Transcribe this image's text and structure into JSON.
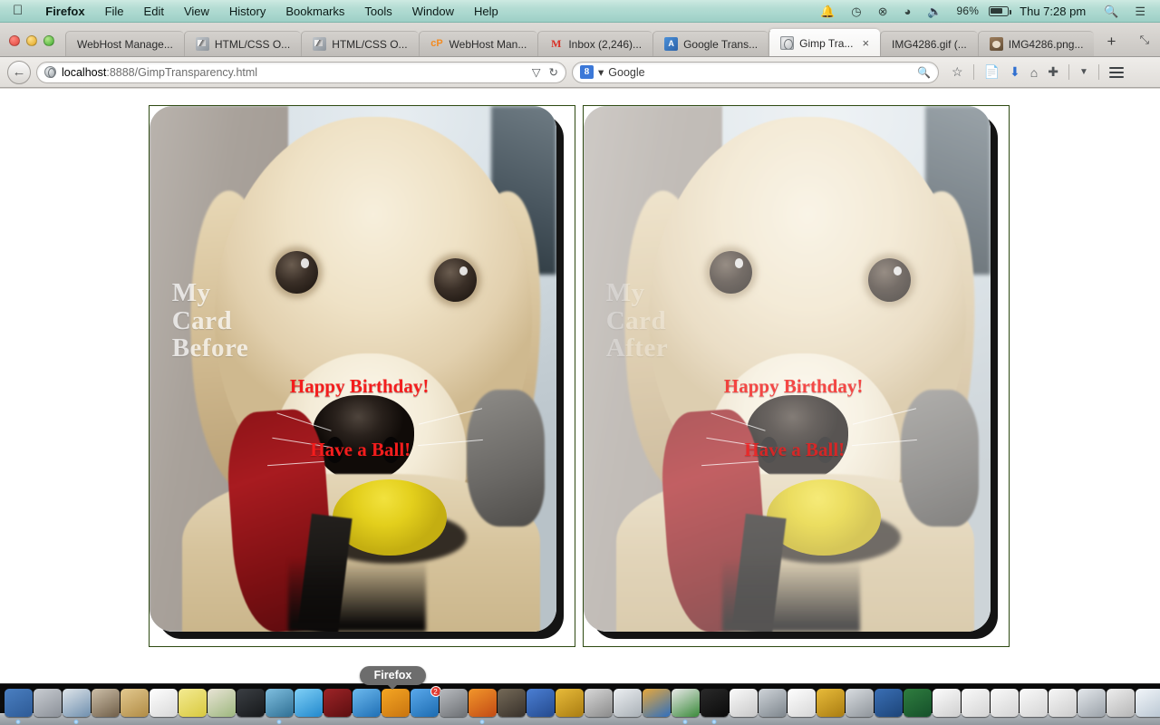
{
  "menubar": {
    "apple_icon": "apple-logo",
    "items": [
      "Firefox",
      "File",
      "Edit",
      "View",
      "History",
      "Bookmarks",
      "Tools",
      "Window",
      "Help"
    ],
    "status_icons": [
      "bell-icon",
      "time-machine-icon",
      "bluetooth-icon",
      "wifi-icon",
      "volume-icon"
    ],
    "battery_percent": "96%",
    "clock": "Thu 7:28 pm",
    "spotlight_icon": "search-icon",
    "notification_icon": "notification-center-icon"
  },
  "browser": {
    "window_controls": [
      "close",
      "minimize",
      "zoom"
    ],
    "tabs": [
      {
        "title": "WebHost Manage...",
        "favicon": "none",
        "active": false,
        "closable": false
      },
      {
        "title": "HTML/CSS O...",
        "favicon": "css-icon",
        "active": false,
        "closable": false
      },
      {
        "title": "HTML/CSS O...",
        "favicon": "css-icon",
        "active": false,
        "closable": false
      },
      {
        "title": "WebHost Man...",
        "favicon": "cpanel-icon",
        "active": false,
        "closable": false
      },
      {
        "title": "Inbox (2,246)...",
        "favicon": "gmail-icon",
        "active": false,
        "closable": false
      },
      {
        "title": "Google Trans...",
        "favicon": "google-translate-icon",
        "active": false,
        "closable": false
      },
      {
        "title": "Gimp Tra...",
        "favicon": "globe-icon",
        "active": true,
        "closable": true
      },
      {
        "title": "IMG4286.gif (...",
        "favicon": "none",
        "active": false,
        "closable": false
      },
      {
        "title": "IMG4286.png...",
        "favicon": "image-thumbnail-icon",
        "active": false,
        "closable": false
      }
    ],
    "new_tab_label": "+",
    "list_all_tabs_label": "⤡",
    "close_label": "×",
    "back_label": "←",
    "url_host": "localhost",
    "url_rest": ":8888/GimpTransparency.html",
    "url_dropdown_label": "▽",
    "url_reload_label": "↻",
    "search_engine_badge": "8",
    "search_engine_name": "Google",
    "search_dropdown_label": "▾",
    "search_magnifier_label": "search-icon",
    "toolbar_icons": [
      "bookmark-star-icon",
      "reading-list-icon",
      "downloads-icon",
      "home-icon",
      "addon-icon",
      "toolbar-overflow-icon",
      "menu-hamburger-icon"
    ]
  },
  "page": {
    "cards": [
      {
        "id": "card-before",
        "label_lines": [
          "My",
          "Card",
          "Before"
        ],
        "message_1": "Happy Birthday!",
        "message_2": "Have a Ball!",
        "label_opacity": "0.70",
        "overlay_wash": "none"
      },
      {
        "id": "card-after",
        "label_lines": [
          "My",
          "Card",
          "After"
        ],
        "message_1": "Happy Birthday!",
        "message_2": "Have a Ball!",
        "label_opacity": "0.30",
        "overlay_wash": "rgba(255,255,255,0.30)"
      }
    ],
    "border_color": "#2e4a12",
    "message_color": "#f41d1d",
    "label_color": "#ffffff",
    "background_color": "#ffffff"
  },
  "dock": {
    "tooltip": "Firefox",
    "items": [
      {
        "name": "finder",
        "colors": [
          "#4a7fc1",
          "#2d5a96"
        ]
      },
      {
        "name": "launchpad",
        "colors": [
          "#c9cdd2",
          "#8b9098"
        ]
      },
      {
        "name": "safari",
        "colors": [
          "#dfe5ea",
          "#6f8fae"
        ]
      },
      {
        "name": "contacts",
        "colors": [
          "#cdbfa8",
          "#6f5e48"
        ]
      },
      {
        "name": "notes-folder",
        "colors": [
          "#e3c98f",
          "#b08b45"
        ]
      },
      {
        "name": "calendar",
        "colors": [
          "#ffffff",
          "#d8d8d8"
        ]
      },
      {
        "name": "stickies",
        "colors": [
          "#f4eb92",
          "#d8c93f"
        ]
      },
      {
        "name": "maps",
        "colors": [
          "#e9e4d6",
          "#9db77e"
        ]
      },
      {
        "name": "photo-booth",
        "colors": [
          "#3b3f44",
          "#16181a"
        ]
      },
      {
        "name": "photos",
        "colors": [
          "#7fbfe0",
          "#2f6f93"
        ]
      },
      {
        "name": "messages",
        "colors": [
          "#7fd0f7",
          "#2288cc"
        ]
      },
      {
        "name": "address-book",
        "colors": [
          "#9d2427",
          "#5c0e10"
        ]
      },
      {
        "name": "itunes",
        "colors": [
          "#6cb9ee",
          "#1f6fb5"
        ]
      },
      {
        "name": "ibooks",
        "colors": [
          "#f5a623",
          "#c87410"
        ]
      },
      {
        "name": "app-store",
        "colors": [
          "#5aa9ec",
          "#1c6bb0"
        ]
      },
      {
        "name": "system-preferences",
        "colors": [
          "#b9bcc0",
          "#6b6e72"
        ]
      },
      {
        "name": "firefox",
        "colors": [
          "#f2962b",
          "#c24a14"
        ]
      },
      {
        "name": "gimp",
        "colors": [
          "#756a58",
          "#37302a"
        ]
      },
      {
        "name": "xcode-tools",
        "colors": [
          "#4b7fd4",
          "#244a8e"
        ]
      },
      {
        "name": "coda",
        "colors": [
          "#e8bb3a",
          "#a97c11"
        ]
      },
      {
        "name": "espresso",
        "colors": [
          "#d8d8d8",
          "#8a8a8a"
        ]
      },
      {
        "name": "fetch",
        "colors": [
          "#eceff2",
          "#a9b0b6"
        ]
      },
      {
        "name": "paintbrush",
        "colors": [
          "#e7a83c",
          "#2f6fbe"
        ]
      },
      {
        "name": "chrome",
        "colors": [
          "#e9e9e9",
          "#3a8a3a"
        ]
      },
      {
        "name": "terminal",
        "colors": [
          "#2a2a2a",
          "#0a0a0a"
        ]
      },
      {
        "name": "text-editor",
        "colors": [
          "#fbfbfb",
          "#c8c8c8"
        ]
      },
      {
        "name": "image-viewer",
        "colors": [
          "#cfd4d9",
          "#7d858c"
        ]
      },
      {
        "name": "blank-document",
        "colors": [
          "#ffffff",
          "#d6d6d6"
        ]
      },
      {
        "name": "coda-2",
        "colors": [
          "#e8bb3a",
          "#a97c11"
        ]
      },
      {
        "name": "scanner",
        "colors": [
          "#d9dde1",
          "#8e949a"
        ]
      },
      {
        "name": "display-prefs",
        "colors": [
          "#3a6fb5",
          "#1c4478"
        ]
      },
      {
        "name": "green-screen",
        "colors": [
          "#2f7d3f",
          "#15502a"
        ]
      },
      {
        "name": "white-window",
        "colors": [
          "#fdfdfd",
          "#cfcfcf"
        ]
      },
      {
        "name": "doc-1",
        "colors": [
          "#fafafa",
          "#d4d4d4"
        ]
      },
      {
        "name": "doc-2",
        "colors": [
          "#fafafa",
          "#d4d4d4"
        ]
      },
      {
        "name": "doc-3",
        "colors": [
          "#fafafa",
          "#d4d4d4"
        ]
      },
      {
        "name": "doc-4",
        "colors": [
          "#f7f7f7",
          "#cccccc"
        ]
      },
      {
        "name": "screen-doc",
        "colors": [
          "#e4e8ec",
          "#9aa1a8"
        ]
      },
      {
        "name": "grid-doc",
        "colors": [
          "#eeeeee",
          "#b5b5b5"
        ]
      },
      {
        "name": "window-doc-1",
        "colors": [
          "#f2f6fa",
          "#b9c6d2"
        ]
      },
      {
        "name": "window-doc-2",
        "colors": [
          "#f2f6fa",
          "#b9c6d2"
        ]
      },
      {
        "name": "window-doc-3",
        "colors": [
          "#f2f6fa",
          "#b9c6d2"
        ]
      },
      {
        "name": "window-doc-4",
        "colors": [
          "#f2f6fa",
          "#b9c6d2"
        ]
      },
      {
        "name": "window-doc-5",
        "colors": [
          "#fafafa",
          "#cdd5dc"
        ]
      },
      {
        "name": "brick-doc",
        "colors": [
          "#8d4a3c",
          "#5d2d23"
        ]
      },
      {
        "name": "report-doc",
        "colors": [
          "#fbfbfb",
          "#cfcfcf"
        ]
      },
      {
        "name": "tool-1",
        "colors": [
          "#e6e6e6",
          "#a8a8a8"
        ]
      },
      {
        "name": "tool-2",
        "colors": [
          "#e6e6e6",
          "#a8a8a8"
        ]
      },
      {
        "name": "trash",
        "colors": [
          "#e8ecef",
          "#9aa2a9"
        ]
      }
    ],
    "running_indices": [
      0,
      2,
      9,
      16,
      23,
      24
    ],
    "badge_index": 14,
    "badge_value": "2"
  }
}
